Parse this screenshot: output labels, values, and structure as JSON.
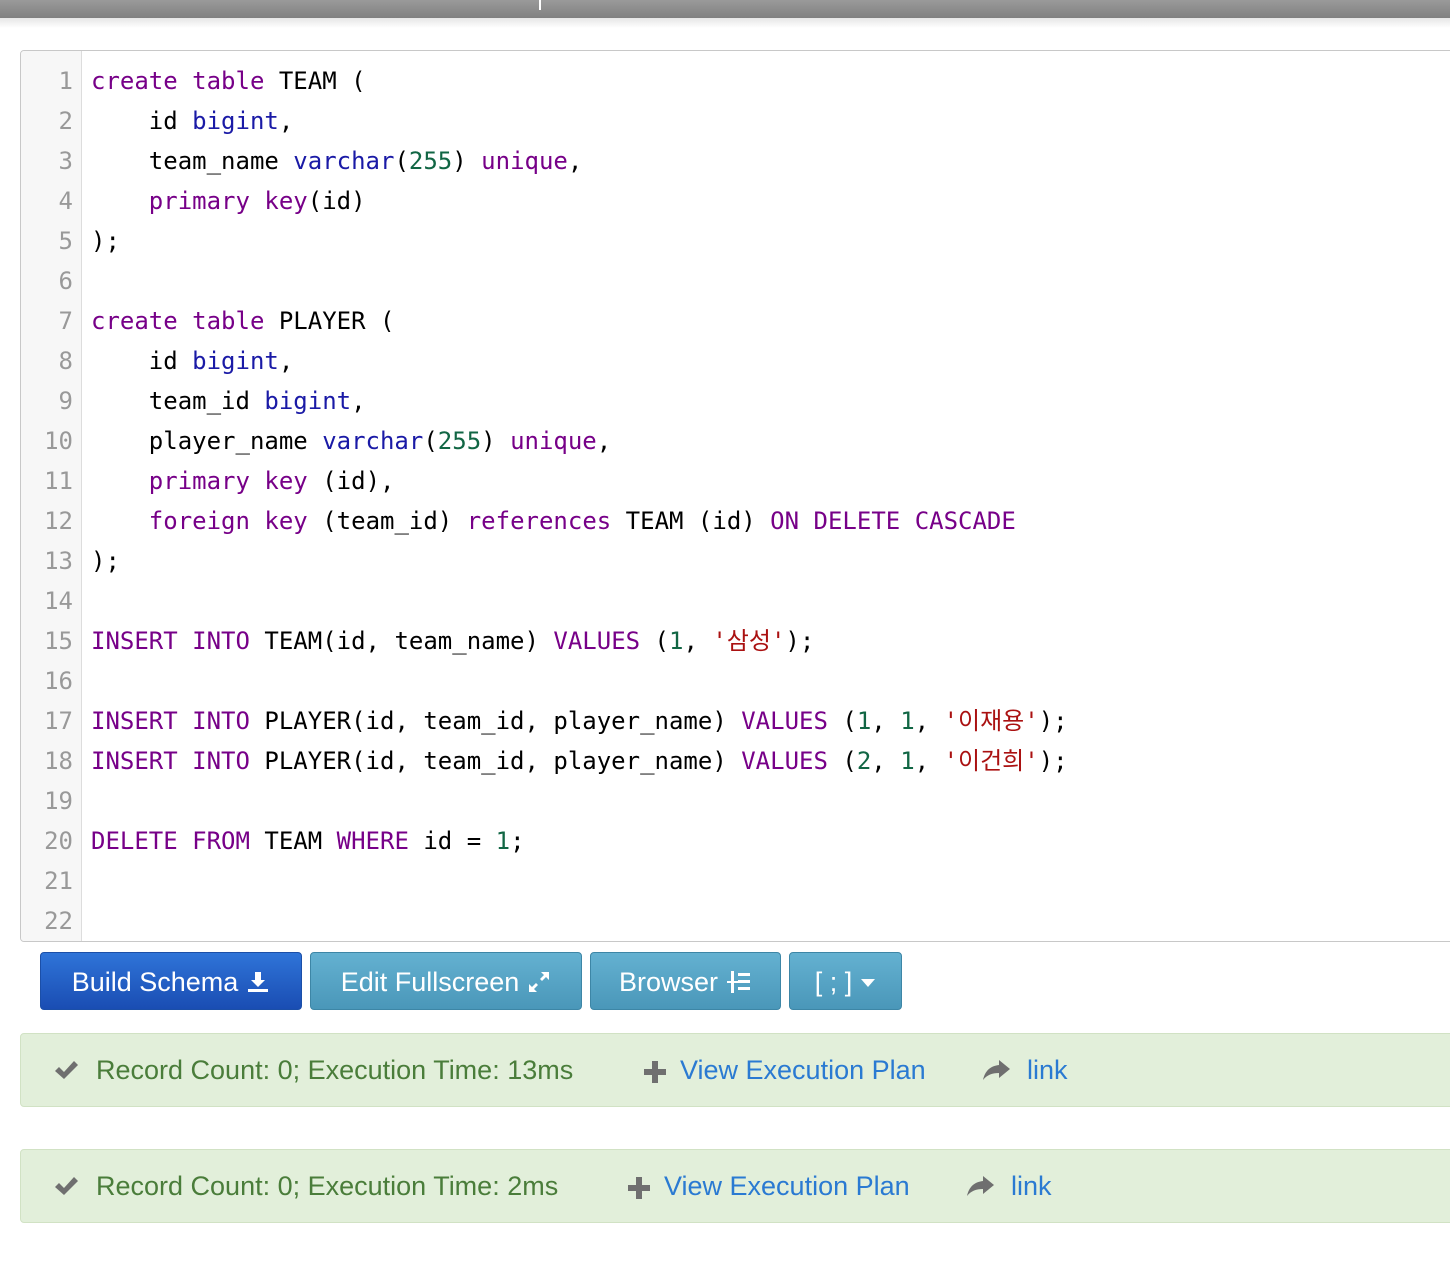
{
  "editor": {
    "lines": [
      {
        "n": "1",
        "tokens": [
          [
            "kw",
            "create"
          ],
          [
            "in",
            " "
          ],
          [
            "kw",
            "table"
          ],
          [
            "in",
            " TEAM ("
          ]
        ]
      },
      {
        "n": "2",
        "tokens": [
          [
            "in",
            "    id "
          ],
          [
            "ty",
            "bigint"
          ],
          [
            "in",
            ","
          ]
        ]
      },
      {
        "n": "3",
        "tokens": [
          [
            "in",
            "    team_name "
          ],
          [
            "ty",
            "varchar"
          ],
          [
            "in",
            "("
          ],
          [
            "nm",
            "255"
          ],
          [
            "in",
            ") "
          ],
          [
            "kw",
            "unique"
          ],
          [
            "in",
            ","
          ]
        ]
      },
      {
        "n": "4",
        "tokens": [
          [
            "in",
            "    "
          ],
          [
            "kw",
            "primary"
          ],
          [
            "in",
            " "
          ],
          [
            "kw",
            "key"
          ],
          [
            "in",
            "(id)"
          ]
        ]
      },
      {
        "n": "5",
        "tokens": [
          [
            "in",
            ");"
          ]
        ]
      },
      {
        "n": "6",
        "tokens": []
      },
      {
        "n": "7",
        "tokens": [
          [
            "kw",
            "create"
          ],
          [
            "in",
            " "
          ],
          [
            "kw",
            "table"
          ],
          [
            "in",
            " PLAYER ("
          ]
        ]
      },
      {
        "n": "8",
        "tokens": [
          [
            "in",
            "    id "
          ],
          [
            "ty",
            "bigint"
          ],
          [
            "in",
            ","
          ]
        ]
      },
      {
        "n": "9",
        "tokens": [
          [
            "in",
            "    team_id "
          ],
          [
            "ty",
            "bigint"
          ],
          [
            "in",
            ","
          ]
        ]
      },
      {
        "n": "10",
        "tokens": [
          [
            "in",
            "    player_name "
          ],
          [
            "ty",
            "varchar"
          ],
          [
            "in",
            "("
          ],
          [
            "nm",
            "255"
          ],
          [
            "in",
            ") "
          ],
          [
            "kw",
            "unique"
          ],
          [
            "in",
            ","
          ]
        ]
      },
      {
        "n": "11",
        "tokens": [
          [
            "in",
            "    "
          ],
          [
            "kw",
            "primary"
          ],
          [
            "in",
            " "
          ],
          [
            "kw",
            "key"
          ],
          [
            "in",
            " (id),"
          ]
        ]
      },
      {
        "n": "12",
        "tokens": [
          [
            "in",
            "    "
          ],
          [
            "kw",
            "foreign"
          ],
          [
            "in",
            " "
          ],
          [
            "kw",
            "key"
          ],
          [
            "in",
            " (team_id) "
          ],
          [
            "kw",
            "references"
          ],
          [
            "in",
            " TEAM (id) "
          ],
          [
            "kw",
            "ON"
          ],
          [
            "in",
            " "
          ],
          [
            "kw",
            "DELETE"
          ],
          [
            "in",
            " "
          ],
          [
            "kw",
            "CASCADE"
          ]
        ]
      },
      {
        "n": "13",
        "tokens": [
          [
            "in",
            ");"
          ]
        ]
      },
      {
        "n": "14",
        "tokens": []
      },
      {
        "n": "15",
        "tokens": [
          [
            "kw",
            "INSERT"
          ],
          [
            "in",
            " "
          ],
          [
            "kw",
            "INTO"
          ],
          [
            "in",
            " TEAM(id, team_name) "
          ],
          [
            "kw",
            "VALUES"
          ],
          [
            "in",
            " ("
          ],
          [
            "nm",
            "1"
          ],
          [
            "in",
            ", "
          ],
          [
            "st",
            "'삼성'"
          ],
          [
            "in",
            ");"
          ]
        ]
      },
      {
        "n": "16",
        "tokens": []
      },
      {
        "n": "17",
        "tokens": [
          [
            "kw",
            "INSERT"
          ],
          [
            "in",
            " "
          ],
          [
            "kw",
            "INTO"
          ],
          [
            "in",
            " PLAYER(id, team_id, player_name) "
          ],
          [
            "kw",
            "VALUES"
          ],
          [
            "in",
            " ("
          ],
          [
            "nm",
            "1"
          ],
          [
            "in",
            ", "
          ],
          [
            "nm",
            "1"
          ],
          [
            "in",
            ", "
          ],
          [
            "st",
            "'이재용'"
          ],
          [
            "in",
            ");"
          ]
        ]
      },
      {
        "n": "18",
        "tokens": [
          [
            "kw",
            "INSERT"
          ],
          [
            "in",
            " "
          ],
          [
            "kw",
            "INTO"
          ],
          [
            "in",
            " PLAYER(id, team_id, player_name) "
          ],
          [
            "kw",
            "VALUES"
          ],
          [
            "in",
            " ("
          ],
          [
            "nm",
            "2"
          ],
          [
            "in",
            ", "
          ],
          [
            "nm",
            "1"
          ],
          [
            "in",
            ", "
          ],
          [
            "st",
            "'이건희'"
          ],
          [
            "in",
            ");"
          ]
        ]
      },
      {
        "n": "19",
        "tokens": []
      },
      {
        "n": "20",
        "tokens": [
          [
            "kw",
            "DELETE"
          ],
          [
            "in",
            " "
          ],
          [
            "kw",
            "FROM"
          ],
          [
            "in",
            " TEAM "
          ],
          [
            "kw",
            "WHERE"
          ],
          [
            "in",
            " id = "
          ],
          [
            "nm",
            "1"
          ],
          [
            "in",
            ";"
          ]
        ]
      },
      {
        "n": "21",
        "tokens": []
      },
      {
        "n": "22",
        "tokens": []
      }
    ]
  },
  "toolbar": {
    "build_schema": "Build Schema",
    "edit_fullscreen": "Edit Fullscreen",
    "browser": "Browser",
    "terminator": "[ ; ]"
  },
  "results": [
    {
      "message": "Record Count: 0; Execution Time: 13ms",
      "plan_label": "View Execution Plan",
      "link_label": "link"
    },
    {
      "message": "Record Count: 0; Execution Time: 2ms",
      "plan_label": "View Execution Plan",
      "link_label": "link"
    }
  ],
  "icons": {
    "build_schema": "download-icon",
    "edit_fullscreen": "expand-icon",
    "browser": "tree-icon",
    "terminator": "caret-down-icon",
    "success": "check-icon",
    "plan": "plus-icon",
    "link": "share-arrow-icon"
  },
  "colors": {
    "keyword": "#770088",
    "type": "#1a1aa6",
    "number": "#116644",
    "string": "#aa1111",
    "btn_primary": "#1f5fc4",
    "btn_info": "#56a3c6",
    "success_bg": "#e2efda",
    "success_text": "#4a7d3a",
    "link": "#2a7ad2"
  }
}
